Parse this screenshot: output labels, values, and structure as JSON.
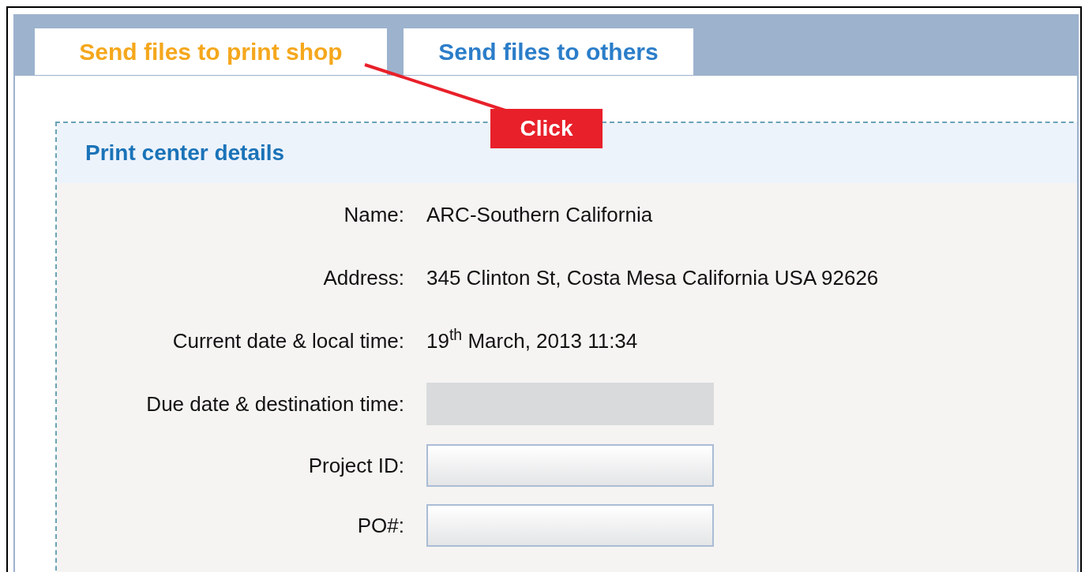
{
  "tabs": [
    {
      "label": "Send files to print shop",
      "selected": true
    },
    {
      "label": "Send files to others",
      "selected": false
    }
  ],
  "callout": {
    "label": "Click"
  },
  "section": {
    "title": "Print center details",
    "rows": [
      {
        "label": "Name:",
        "kind": "text",
        "value": "ARC-Southern California"
      },
      {
        "label": "Address:",
        "kind": "text",
        "value": "345 Clinton St, Costa Mesa California USA 92626"
      },
      {
        "label": "Current date & local time:",
        "kind": "text",
        "value": "19$^{th}$ March, 2013 11:34"
      },
      {
        "label": "Due date & destination time:",
        "kind": "disabled"
      },
      {
        "label": "Project ID:",
        "kind": "input"
      },
      {
        "label": "PO#:",
        "kind": "input"
      }
    ]
  }
}
